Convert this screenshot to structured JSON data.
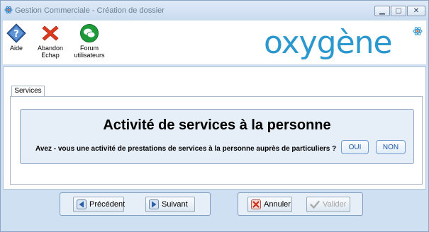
{
  "window": {
    "title": "Gestion Commerciale - Création de dossier",
    "controls": {
      "minimize": "▁",
      "maximize": "▢",
      "close": "✕"
    }
  },
  "toolbar": {
    "aide": "Aide",
    "abandon_line1": "Abandon",
    "abandon_line2": "Echap",
    "forum_line1": "Forum",
    "forum_line2": "utilisateurs"
  },
  "logo": {
    "text": "oxygène",
    "color": "#2a97cf"
  },
  "tabs": [
    "Services"
  ],
  "panel": {
    "heading": "Activité de services à la personne",
    "question": "Avez - vous une activité de prestations de services à la personne auprès de particuliers ?",
    "yes_label": "OUI",
    "no_label": "NON"
  },
  "navigation": {
    "previous_label": "Précédent",
    "next_label": "Suivant",
    "cancel_label": "Annuler",
    "validate_label": "Valider",
    "validate_enabled": false
  },
  "colors": {
    "accent": "#2a97cf",
    "panel_bg": "#e6eef7",
    "frame_bg": "#cfe0f2",
    "abandon_icon": "#e03a1e",
    "forum_icon": "#1e9a38",
    "help_icon": "#2b5aa0"
  },
  "icons": {
    "app": "app-atom-icon",
    "help": "help-question-icon",
    "abandon": "red-cross-icon",
    "forum": "forum-chat-icon",
    "previous": "arrow-left-icon",
    "next": "arrow-right-icon",
    "cancel": "red-x-icon",
    "validate": "checkmark-icon"
  }
}
